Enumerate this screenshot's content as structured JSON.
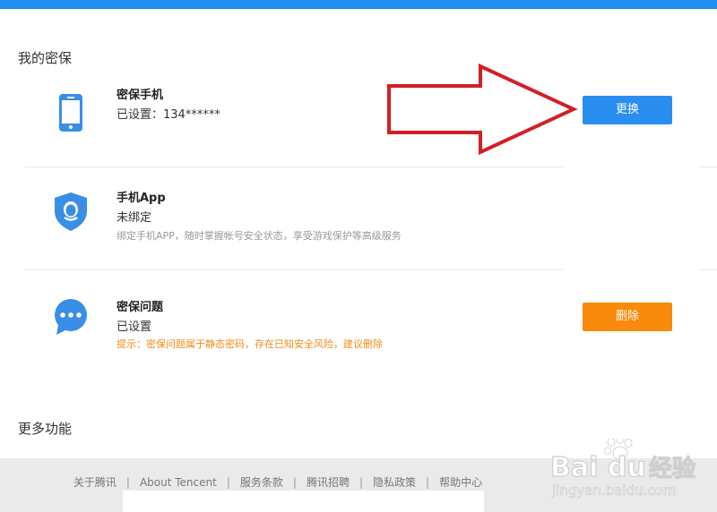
{
  "page": {
    "section_title": "我的密保",
    "more_title": "更多功能"
  },
  "items": [
    {
      "name": "密保手机",
      "status": "已设置：134******",
      "button": "更换"
    },
    {
      "name": "手机App",
      "status": "未绑定",
      "desc": "绑定手机APP，随时掌握帐号安全状态，享受游戏保护等高级服务"
    },
    {
      "name": "密保问题",
      "status": "已设置",
      "warn": "提示：密保问题属于静态密码，存在已知安全风险，建议删除",
      "button": "删除"
    }
  ],
  "footer": {
    "links": [
      "关于腾讯",
      "About Tencent",
      "服务条款",
      "腾讯招聘",
      "隐私政策",
      "帮助中心"
    ],
    "separator": "|"
  },
  "watermark": {
    "brand": "Bai du",
    "product": "经验",
    "url": "jingyan.baidu.com"
  },
  "colors": {
    "accent_blue": "#2a8ef0",
    "warn_orange": "#f98a0b",
    "arrow_red": "#d21f26"
  },
  "icons": {
    "phone": "mobile-phone-icon",
    "app": "qq-shield-icon",
    "question": "chat-bubble-icon"
  }
}
